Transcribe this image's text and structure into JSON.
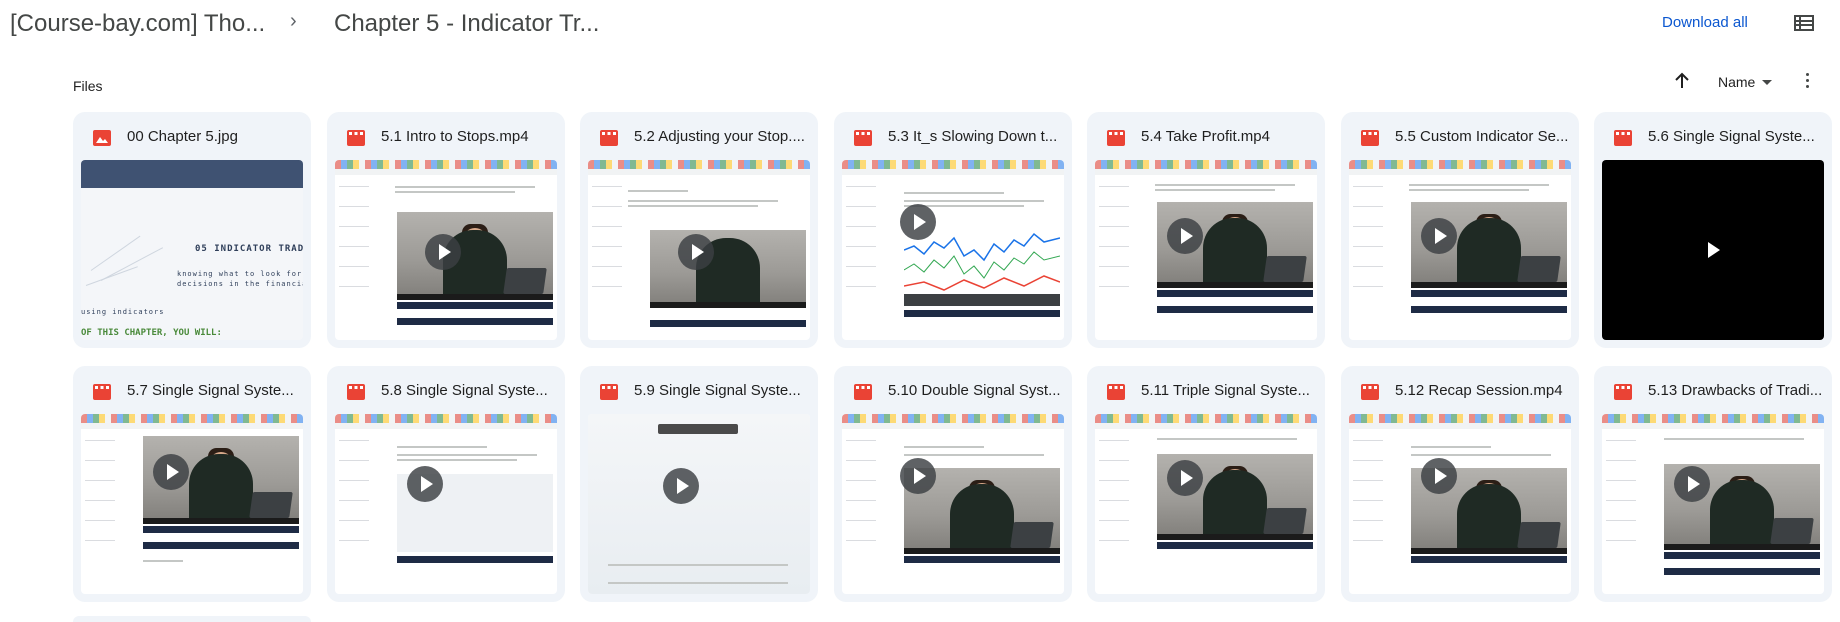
{
  "breadcrumb": {
    "parent": "[Course-bay.com] Tho...",
    "separator": "›",
    "current": "Chapter 5 - Indicator Tr..."
  },
  "toolbar": {
    "download_all": "Download all",
    "list_view_icon": "list-view-icon"
  },
  "section": {
    "files_label": "Files",
    "sort_label": "Name",
    "sort_direction_icon": "arrow-up-icon",
    "more_icon": "more-vertical-icon"
  },
  "colors": {
    "accent": "#0b57d0",
    "card_bg": "#f0f4f9",
    "file_icon_red": "#ea4335"
  },
  "files": [
    {
      "name": "00 Chapter 5.jpg",
      "type": "image",
      "icon": "image-file-icon"
    },
    {
      "name": "5.1 Intro to Stops.mp4",
      "type": "video",
      "icon": "video-file-icon"
    },
    {
      "name": "5.2 Adjusting your Stop....",
      "type": "video",
      "icon": "video-file-icon"
    },
    {
      "name": "5.3 It_s Slowing Down t...",
      "type": "video",
      "icon": "video-file-icon"
    },
    {
      "name": "5.4 Take Profit.mp4",
      "type": "video",
      "icon": "video-file-icon"
    },
    {
      "name": "5.5 Custom Indicator Se...",
      "type": "video",
      "icon": "video-file-icon"
    },
    {
      "name": "5.6 Single Signal Syste...",
      "type": "video",
      "icon": "video-file-icon"
    },
    {
      "name": "5.7 Single Signal Syste...",
      "type": "video",
      "icon": "video-file-icon"
    },
    {
      "name": "5.8 Single Signal Syste...",
      "type": "video",
      "icon": "video-file-icon"
    },
    {
      "name": "5.9 Single Signal Syste...",
      "type": "video",
      "icon": "video-file-icon"
    },
    {
      "name": "5.10 Double Signal Syst...",
      "type": "video",
      "icon": "video-file-icon"
    },
    {
      "name": "5.11 Triple Signal Syste...",
      "type": "video",
      "icon": "video-file-icon"
    },
    {
      "name": "5.12 Recap Session.mp4",
      "type": "video",
      "icon": "video-file-icon"
    },
    {
      "name": "5.13 Drawbacks of Tradi...",
      "type": "video",
      "icon": "video-file-icon"
    }
  ],
  "image_thumb": {
    "title_text": "05 INDICATOR TRAD",
    "sub_text_1": "knowing what to look for in the in",
    "sub_text_2": "decisions in the financial markets",
    "side_text": "using indicators",
    "footer_text": "OF THIS CHAPTER, YOU WILL:"
  }
}
